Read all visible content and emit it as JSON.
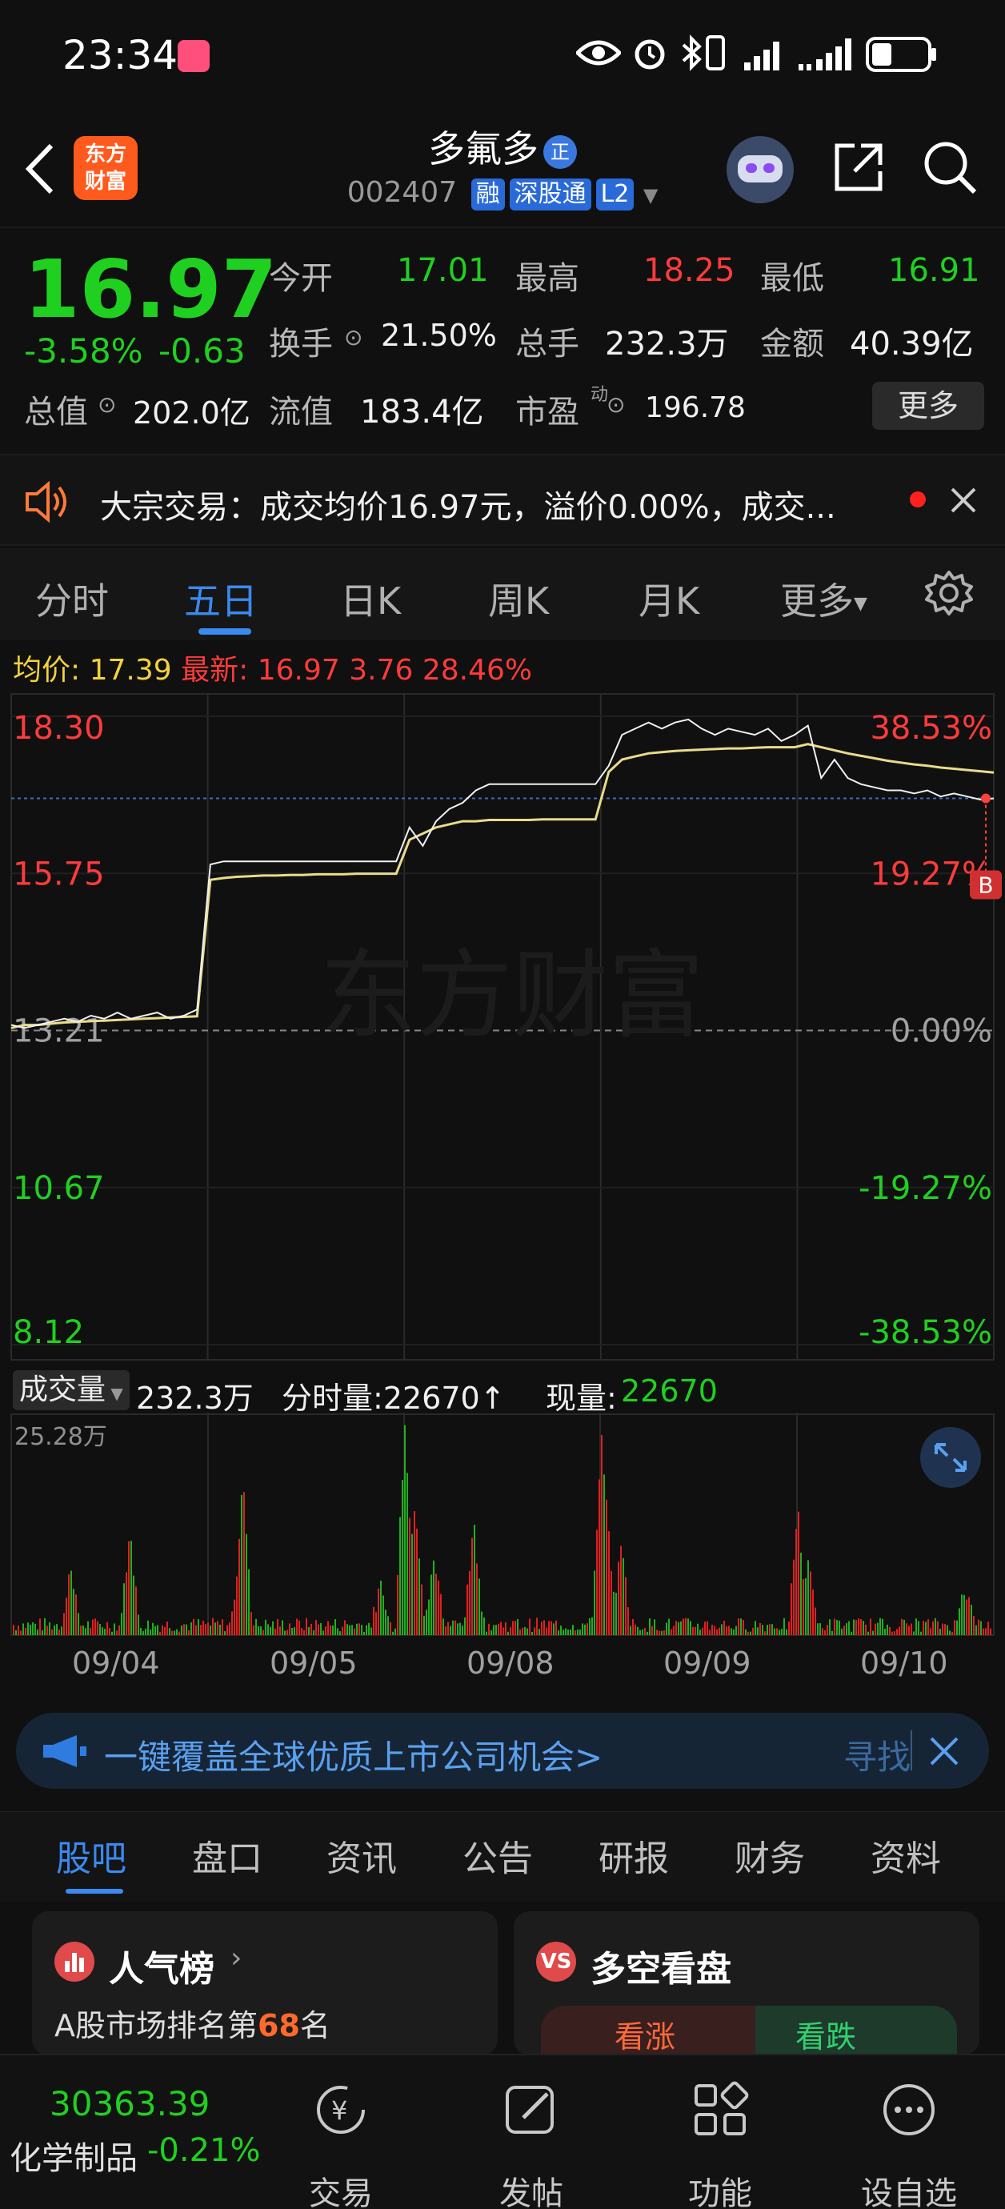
{
  "status_bar": {
    "time": "23:34"
  },
  "header": {
    "title": "多氟多",
    "title_badge": "正",
    "code": "002407",
    "tags": [
      "融",
      "深股通",
      "L2"
    ],
    "logo_text": [
      "东方",
      "财富"
    ]
  },
  "quote": {
    "price": "16.97",
    "change_pct": "-3.58%",
    "change": "-0.63",
    "open_label": "今开",
    "open": "17.01",
    "high_label": "最高",
    "high": "18.25",
    "low_label": "最低",
    "low": "16.91",
    "turnover_label": "换手",
    "turnover": "21.50%",
    "volume_label": "总手",
    "volume": "232.3万",
    "amount_label": "金额",
    "amount": "40.39亿",
    "mktcap_label": "总值",
    "mktcap": "202.0亿",
    "float_label": "流值",
    "float": "183.4亿",
    "pe_label": "市盈",
    "pe_sup": "动",
    "pe": "196.78",
    "more_label": "更多"
  },
  "announce": {
    "text": "大宗交易：成交均价16.97元，溢价0.00%，成交..."
  },
  "tabs": [
    "分时",
    "五日",
    "日K",
    "周K",
    "月K",
    "更多"
  ],
  "active_tab": 1,
  "avg_info": {
    "avg_label": "均价:",
    "avg": "17.39",
    "latest_label": "最新:",
    "latest": "16.97",
    "latest_chg": "3.76",
    "latest_pct": "28.46%"
  },
  "chart_data": {
    "type": "line",
    "title": "",
    "y_left_ticks": [
      "18.30",
      "15.75",
      "13.21",
      "10.67",
      "8.12"
    ],
    "y_right_ticks": [
      "38.53%",
      "19.27%",
      "0.00%",
      "-19.27%",
      "-38.53%"
    ],
    "ylim": [
      8.12,
      18.3
    ],
    "x_categories": [
      "09/04",
      "09/05",
      "09/08",
      "09/09",
      "09/10"
    ],
    "series": [
      {
        "name": "price",
        "values": [
          13.3,
          13.25,
          13.3,
          13.35,
          13.4,
          13.35,
          13.45,
          13.4,
          13.5,
          13.4,
          13.45,
          13.5,
          13.4,
          13.45,
          13.55,
          15.9,
          15.95,
          15.95,
          15.95,
          15.95,
          15.95,
          15.95,
          15.95,
          15.95,
          15.95,
          15.95,
          15.95,
          15.95,
          15.95,
          15.95,
          16.5,
          16.2,
          16.6,
          16.8,
          16.9,
          17.1,
          17.2,
          17.2,
          17.2,
          17.2,
          17.2,
          17.2,
          17.2,
          17.2,
          17.2,
          17.5,
          18.0,
          18.1,
          18.2,
          18.1,
          18.2,
          18.25,
          18.1,
          18.0,
          18.1,
          18.05,
          18.0,
          18.1,
          17.9,
          18.0,
          18.15,
          17.3,
          17.6,
          17.3,
          17.2,
          17.15,
          17.1,
          17.1,
          17.05,
          17.1,
          17.0,
          17.05,
          17.0,
          16.95,
          16.97
        ]
      },
      {
        "name": "avg",
        "values": [
          13.25,
          13.3,
          13.3,
          13.32,
          13.34,
          13.35,
          13.36,
          13.37,
          13.38,
          13.39,
          13.4,
          13.41,
          13.42,
          13.43,
          13.44,
          15.65,
          15.68,
          15.7,
          15.71,
          15.72,
          15.72,
          15.73,
          15.73,
          15.74,
          15.74,
          15.74,
          15.75,
          15.75,
          15.75,
          15.75,
          16.3,
          16.4,
          16.5,
          16.55,
          16.6,
          16.6,
          16.62,
          16.62,
          16.62,
          16.62,
          16.63,
          16.63,
          16.63,
          16.63,
          16.63,
          17.4,
          17.6,
          17.65,
          17.7,
          17.72,
          17.74,
          17.75,
          17.76,
          17.77,
          17.78,
          17.78,
          17.79,
          17.8,
          17.8,
          17.8,
          17.85,
          17.8,
          17.75,
          17.7,
          17.66,
          17.62,
          17.58,
          17.55,
          17.52,
          17.5,
          17.47,
          17.45,
          17.43,
          17.41,
          17.39
        ]
      }
    ],
    "ref_price": "13.21",
    "watermark": "东方财富",
    "marker": "B"
  },
  "volume": {
    "label": "成交量",
    "total": "232.3万",
    "tick_label": "分时量:22670↑",
    "now_label": "现量:",
    "now": "22670",
    "max_tick": "25.28万"
  },
  "ad": {
    "text": "一键覆盖全球优质上市公司机会>",
    "action": "寻找"
  },
  "bottom_tabs": [
    "股吧",
    "盘口",
    "资讯",
    "公告",
    "研报",
    "财务",
    "资料"
  ],
  "cards": {
    "left_title": "人气榜",
    "left_prefix": "A股市场排名第",
    "left_rank": "68",
    "left_suffix": "名",
    "right_title": "多空看盘",
    "bull": "看涨",
    "bear": "看跌"
  },
  "bottom_nav": {
    "index_value": "30363.39",
    "index_name": "化学制品",
    "index_chg": "-0.21%",
    "items": [
      "交易",
      "发帖",
      "功能",
      "设自选"
    ]
  }
}
